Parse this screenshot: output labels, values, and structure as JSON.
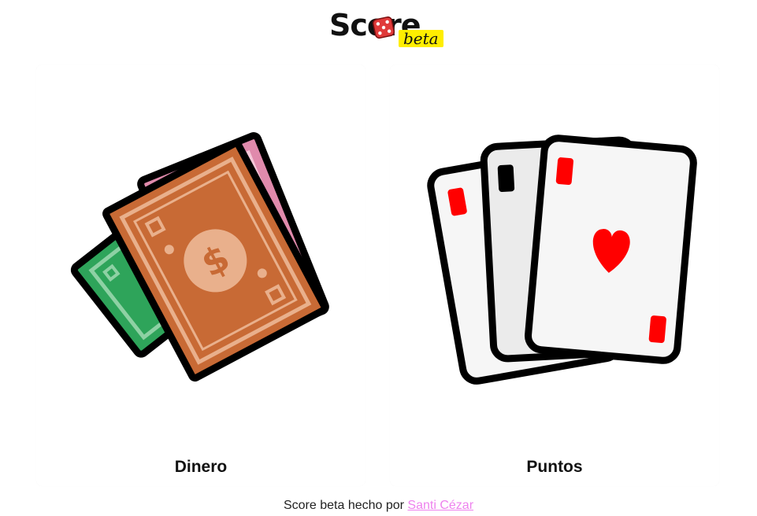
{
  "header": {
    "logo_text": "Score",
    "logo_badge": "beta"
  },
  "options": [
    {
      "label": "Dinero",
      "icon": "money-bills-icon"
    },
    {
      "label": "Puntos",
      "icon": "playing-cards-icon"
    }
  ],
  "footer": {
    "prefix": "Score beta hecho por",
    "author_link": "Santi Cézar"
  },
  "colors": {
    "logo_badge_bg": "#ffee00",
    "link": "#ee82ee",
    "bill_green": "#2ea45a",
    "bill_pink": "#e08aac",
    "bill_orange": "#c86a35",
    "card_red": "#ff0000"
  }
}
